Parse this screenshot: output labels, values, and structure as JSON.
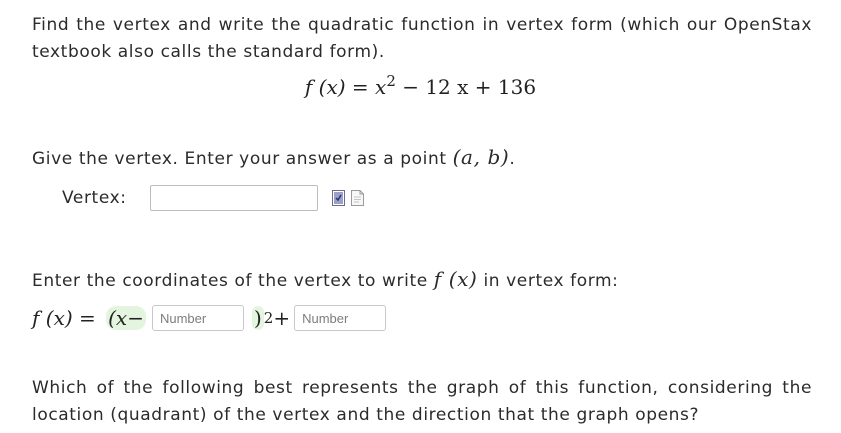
{
  "intro": {
    "text": "Find the vertex and write the quadratic function in vertex form (which our OpenStax textbook also calls the standard form)."
  },
  "formula": {
    "lhs": "f (x) = x",
    "exponent": "2",
    "rest": " − 12 x + 136"
  },
  "question1": {
    "text_before": "Give the vertex. Enter your answer as a point ",
    "point": "(a, b)",
    "text_after": "."
  },
  "vertex": {
    "label": "Vertex:",
    "value": "",
    "icons": [
      "preview-icon",
      "help-icon"
    ]
  },
  "question2": {
    "text_before": "Enter the coordinates of the vertex to write ",
    "fx": "f (x)",
    "text_after": " in vertex form:"
  },
  "equation": {
    "lhs": "f (x) = ",
    "open": "(x−",
    "input1_placeholder": "Number",
    "close": ")",
    "exponent": "2",
    "plus": "+",
    "input2_placeholder": "Number"
  },
  "question3": {
    "text": "Which of the following best represents the graph of this function, considering the location (quadrant) of the vertex and the direction that the graph opens?"
  }
}
